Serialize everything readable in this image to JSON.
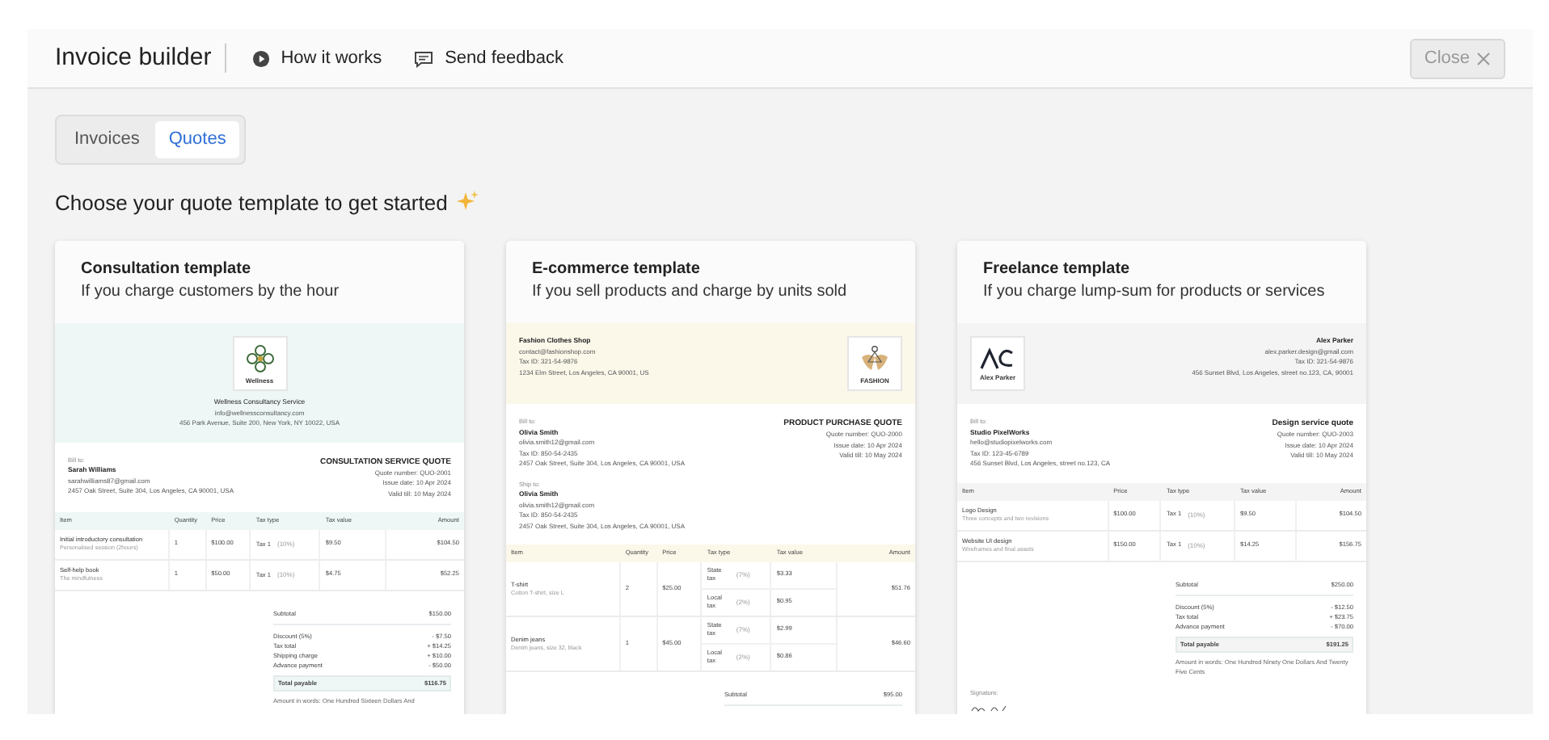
{
  "header": {
    "title": "Invoice builder",
    "links": [
      {
        "label": "How it works",
        "kind": "play"
      },
      {
        "label": "Send feedback",
        "kind": "chat"
      }
    ],
    "close": {
      "label": "Close",
      "disabled": true
    }
  },
  "tabs": [
    {
      "label": "Invoices",
      "selected": false
    },
    {
      "label": "Quotes",
      "selected": true
    }
  ],
  "heading": "Choose your quote template to get started",
  "templates": [
    {
      "title": "Consultation template",
      "subtitle": "If you charge customers by the hour",
      "color": "#eef7f6",
      "company": {
        "kind": "center",
        "logo": {
          "kind": "flower",
          "caption": "Wellness"
        },
        "name": "Wellness Consultancy Service",
        "lines": [
          "info@wellnessconsultancy.com",
          "456 Park Avenue, Suite 200, New York, NY 10022, USA"
        ]
      },
      "bill_to": {
        "label": "Bill to:",
        "name": "Sarah Williams",
        "lines": [
          "sarahwilliams87@gmail.com",
          "2457 Oak Street, Suite 304, Los Angeles, CA 90001, USA"
        ]
      },
      "quote": {
        "title": "CONSULTATION SERVICE QUOTE",
        "lines": [
          "Quote number: QUO-2001",
          "Issue date: 10 Apr 2024",
          "Valid till: 10 May 2024"
        ]
      },
      "columns": [
        "Item",
        "Quantity",
        "Price",
        "Tax type",
        "Tax value",
        "Amount"
      ],
      "rows": [
        {
          "item": "Initial introductory consultation",
          "description": "Personalised session (2hours)",
          "quantity": "1",
          "price": "$100.00",
          "taxes": [
            {
              "type": "Tax 1",
              "rate": "(10%)",
              "value": "$9.50"
            }
          ],
          "amount": "$104.50"
        },
        {
          "item": "Self-help book",
          "description": "The mindfulness",
          "quantity": "1",
          "price": "$50.00",
          "taxes": [
            {
              "type": "Tax 1",
              "rate": "(10%)",
              "value": "$4.75"
            }
          ],
          "amount": "$52.25"
        }
      ],
      "subtotal": {
        "label": "Subtotal",
        "value": "$150.00"
      },
      "adjustments": [
        {
          "label": "Discount (5%)",
          "value": "- $7.50"
        },
        {
          "label": "Tax total",
          "value": "+ $14.25"
        },
        {
          "label": "Shipping charge",
          "value": "+ $10.00"
        },
        {
          "label": "Advance payment",
          "value": "- $50.00"
        }
      ],
      "total": {
        "label": "Total payable",
        "value": "$116.75"
      },
      "in_words": "Amount in words: One Hundred Sixteen Dollars And"
    },
    {
      "title": "E-commerce template",
      "subtitle": "If you sell products and charge by units sold",
      "color": "#fbf8ea",
      "company": {
        "kind": "left",
        "logo": {
          "kind": "hanger",
          "caption": "FASHION"
        },
        "name": "Fashion Clothes Shop",
        "lines": [
          "contact@fashionshop.com",
          "Tax ID: 321-54-9876",
          "1234 Elm Street, Los Angeles, CA 90001, US"
        ]
      },
      "bill_to": {
        "label": "Bill to:",
        "name": "Olivia Smith",
        "lines": [
          "olivia.smith12@gmail.com",
          "Tax ID: 850-54-2435",
          "2457 Oak Street, Suite 304, Los Angeles, CA 90001, USA"
        ]
      },
      "quote": {
        "title": "PRODUCT PURCHASE QUOTE",
        "lines": [
          "Quote number: QUO-2000",
          "Issue date: 10 Apr 2024",
          "Valid till: 10 May 2024"
        ]
      },
      "ship_to": {
        "label": "Ship to:",
        "name": "Olivia Smith",
        "lines": [
          "olivia.smith12@gmail.com",
          "Tax ID: 850-54-2435",
          "2457 Oak Street, Suite 304, Los Angeles, CA 90001, USA"
        ]
      },
      "columns": [
        "Item",
        "Quantity",
        "Price",
        "Tax type",
        "Tax value",
        "Amount"
      ],
      "rows": [
        {
          "item": "T-shirt",
          "description": "Cotton T-shirt, size L",
          "quantity": "2",
          "price": "$25.00",
          "taxes": [
            {
              "type": "State tax",
              "rate": "(7%)",
              "value": "$3.33"
            },
            {
              "type": "Local tax",
              "rate": "(2%)",
              "value": "$0.95"
            }
          ],
          "amount": "$51.76"
        },
        {
          "item": "Denim jeans",
          "description": "Denim jeans, size 32, black",
          "quantity": "1",
          "price": "$45.00",
          "taxes": [
            {
              "type": "State tax",
              "rate": "(7%)",
              "value": "$2.99"
            },
            {
              "type": "Local tax",
              "rate": "(2%)",
              "value": "$0.86"
            }
          ],
          "amount": "$46.60"
        }
      ],
      "subtotal": {
        "label": "Subtotal",
        "value": "$95.00"
      }
    },
    {
      "title": "Freelance template",
      "subtitle": "If you charge lump-sum for products or services",
      "color": "#f4f4f5",
      "company": {
        "kind": "right",
        "logo": {
          "kind": "monogram",
          "caption": "Alex Parker"
        },
        "name": "Alex Parker",
        "lines": [
          "alex.parker.design@gmail.com",
          "Tax ID: 321-54-9876",
          "456 Sunset Blvd, Los Angeles, street no.123, CA, 90001"
        ]
      },
      "bill_to": {
        "label": "Bill to:",
        "name": "Studio PixelWorks",
        "lines": [
          "hello@studiopixelworks.com",
          "Tax ID: 123-45-6789",
          "456 Sunset Blvd, Los Angeles, street no.123, CA"
        ]
      },
      "quote": {
        "title": "Design service quote",
        "lines": [
          "Quote number: QUO-2003",
          "Issue date: 10 Apr 2024",
          "Valid till: 10 May 2024"
        ]
      },
      "columns": [
        "Item",
        "Price",
        "Tax type",
        "Tax value",
        "Amount"
      ],
      "rows": [
        {
          "item": "Logo Design",
          "description": "Three concepts and two revisions",
          "price": "$100.00",
          "taxes": [
            {
              "type": "Tax 1",
              "rate": "(10%)",
              "value": "$9.50"
            }
          ],
          "amount": "$104.50"
        },
        {
          "item": "Website UI design",
          "description": "Wireframes and final assets",
          "price": "$150.00",
          "taxes": [
            {
              "type": "Tax 1",
              "rate": "(10%)",
              "value": "$14.25"
            }
          ],
          "amount": "$156.75"
        }
      ],
      "subtotal": {
        "label": "Subtotal",
        "value": "$250.00"
      },
      "adjustments": [
        {
          "label": "Discount (5%)",
          "value": "- $12.50"
        },
        {
          "label": "Tax total",
          "value": "+ $23.75"
        },
        {
          "label": "Advance payment",
          "value": "- $70.00"
        }
      ],
      "total": {
        "label": "Total payable",
        "value": "$191.25"
      },
      "in_words": "Amount in words: One Hundred Ninety One Dollars And Twenty Five Cents",
      "signature": {
        "label": "Signature:"
      }
    }
  ]
}
